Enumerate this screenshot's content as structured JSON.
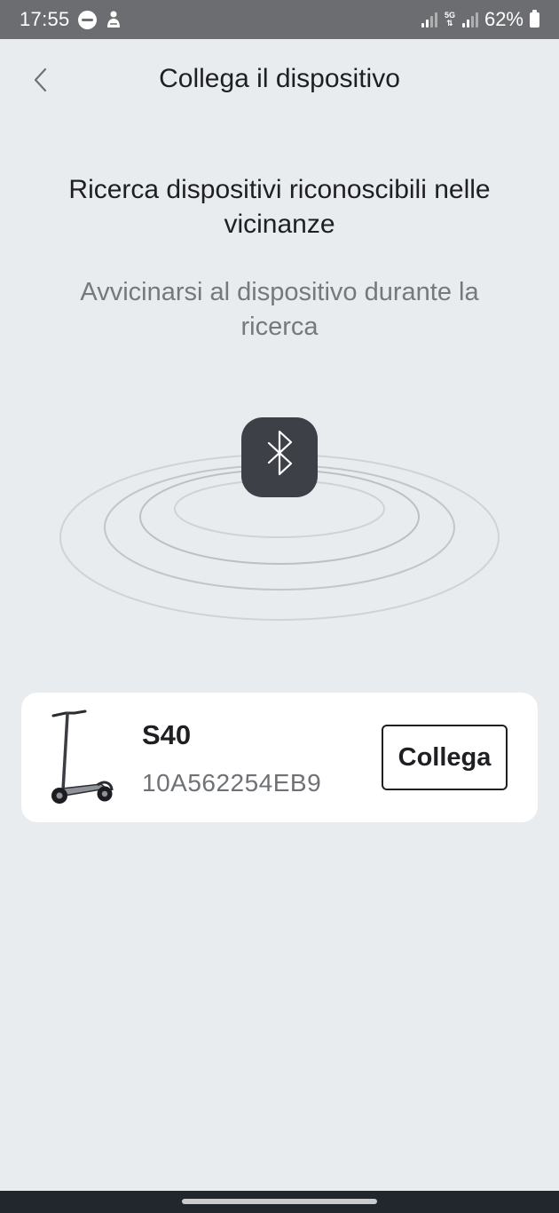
{
  "status_bar": {
    "time": "17:55",
    "battery": "62%",
    "network": "5G",
    "icons": [
      "wear-icon",
      "person-notification-icon",
      "signal-icon",
      "5g-icon",
      "signal-icon",
      "battery-icon"
    ]
  },
  "header": {
    "back_icon": "chevron-left-icon",
    "title": "Collega il dispositivo"
  },
  "main": {
    "headline": "Ricerca dispositivi riconoscibili nelle vicinanze",
    "subhead": "Avvicinarsi al dispositivo durante la ricerca",
    "scan_icon": "bluetooth-icon"
  },
  "device": {
    "image": "scooter-image",
    "name": "S40",
    "id": "10A562254EB9",
    "connect_label": "Collega"
  },
  "colors": {
    "background": "#e9ecef",
    "status_bar": "#6b6d71",
    "bluetooth_badge": "#3d4047",
    "card": "#ffffff",
    "text_primary": "#1e1f23",
    "text_secondary": "#75787d",
    "nav_bar": "#22262d"
  }
}
